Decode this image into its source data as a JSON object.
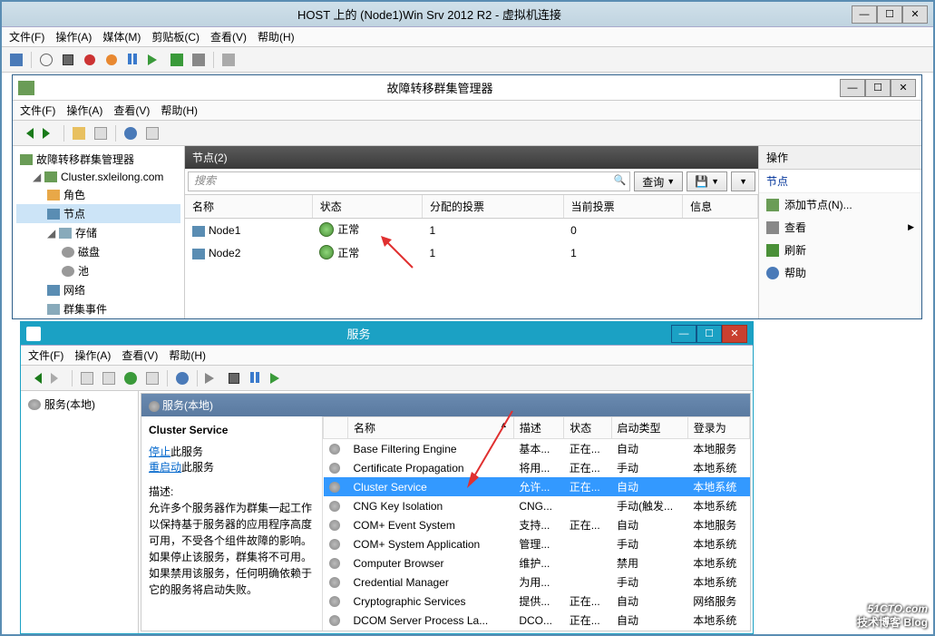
{
  "vm": {
    "title": "HOST 上的 (Node1)Win Srv 2012 R2 - 虚拟机连接",
    "menu": [
      "文件(F)",
      "操作(A)",
      "媒体(M)",
      "剪贴板(C)",
      "查看(V)",
      "帮助(H)"
    ]
  },
  "fc": {
    "title": "故障转移群集管理器",
    "menu": [
      "文件(F)",
      "操作(A)",
      "查看(V)",
      "帮助(H)"
    ],
    "tree": {
      "root": "故障转移群集管理器",
      "cluster": "Cluster.sxleilong.com",
      "roles": "角色",
      "nodes": "节点",
      "storage": "存储",
      "disks": "磁盘",
      "pools": "池",
      "network": "网络",
      "events": "群集事件"
    },
    "nodes_panel": {
      "header": "节点(2)",
      "search_placeholder": "搜索",
      "query_btn": "查询",
      "cols": {
        "name": "名称",
        "status": "状态",
        "assigned": "分配的投票",
        "current": "当前投票",
        "info": "信息"
      },
      "rows": [
        {
          "name": "Node1",
          "status": "正常",
          "assigned": "1",
          "current": "0"
        },
        {
          "name": "Node2",
          "status": "正常",
          "assigned": "1",
          "current": "1"
        }
      ]
    },
    "actions": {
      "header": "操作",
      "sub": "节点",
      "items": {
        "add": "添加节点(N)...",
        "view": "查看",
        "refresh": "刷新",
        "help": "帮助"
      }
    }
  },
  "svc": {
    "title": "服务",
    "menu": [
      "文件(F)",
      "操作(A)",
      "查看(V)",
      "帮助(H)"
    ],
    "tree_item": "服务(本地)",
    "panel_header": "服务(本地)",
    "detail": {
      "name": "Cluster Service",
      "stop_pre": "停止",
      "stop_post": "此服务",
      "restart_pre": "重启动",
      "restart_post": "此服务",
      "desc_label": "描述:",
      "desc": "允许多个服务器作为群集一起工作以保持基于服务器的应用程序高度可用，不受各个组件故障的影响。如果停止该服务，群集将不可用。如果禁用该服务，任何明确依赖于它的服务将启动失败。"
    },
    "cols": {
      "name": "名称",
      "desc": "描述",
      "status": "状态",
      "startup": "启动类型",
      "logon": "登录为"
    },
    "rows": [
      {
        "name": "Base Filtering Engine",
        "desc": "基本...",
        "status": "正在...",
        "startup": "自动",
        "logon": "本地服务"
      },
      {
        "name": "Certificate Propagation",
        "desc": "将用...",
        "status": "正在...",
        "startup": "手动",
        "logon": "本地系统"
      },
      {
        "name": "Cluster Service",
        "desc": "允许...",
        "status": "正在...",
        "startup": "自动",
        "logon": "本地系统",
        "selected": true
      },
      {
        "name": "CNG Key Isolation",
        "desc": "CNG...",
        "status": "",
        "startup": "手动(触发...",
        "logon": "本地系统"
      },
      {
        "name": "COM+ Event System",
        "desc": "支持...",
        "status": "正在...",
        "startup": "自动",
        "logon": "本地服务"
      },
      {
        "name": "COM+ System Application",
        "desc": "管理...",
        "status": "",
        "startup": "手动",
        "logon": "本地系统"
      },
      {
        "name": "Computer Browser",
        "desc": "维护...",
        "status": "",
        "startup": "禁用",
        "logon": "本地系统"
      },
      {
        "name": "Credential Manager",
        "desc": "为用...",
        "status": "",
        "startup": "手动",
        "logon": "本地系统"
      },
      {
        "name": "Cryptographic Services",
        "desc": "提供...",
        "status": "正在...",
        "startup": "自动",
        "logon": "网络服务"
      },
      {
        "name": "DCOM Server Process La...",
        "desc": "DCO...",
        "status": "正在...",
        "startup": "自动",
        "logon": "本地系统"
      }
    ]
  },
  "watermark": {
    "text": "51CTO.com",
    "sub": "技术博客  Blog"
  }
}
